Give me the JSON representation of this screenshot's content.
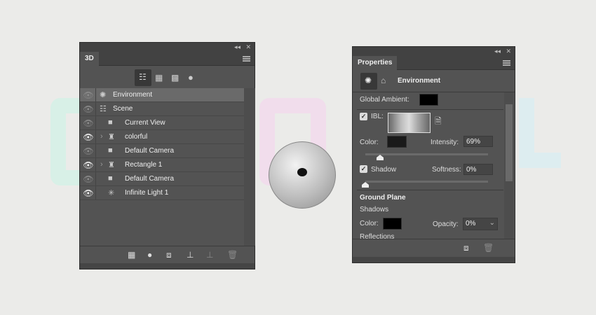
{
  "panel3d": {
    "tab": "3D",
    "filters": [
      "scene-filter",
      "mesh-filter",
      "material-filter",
      "light-filter"
    ],
    "layers": [
      {
        "label": "Environment",
        "visible": false,
        "icon": "environment-icon",
        "indent": 0,
        "selected": true
      },
      {
        "label": "Scene",
        "visible": false,
        "icon": "scene-icon",
        "indent": 0
      },
      {
        "label": "Current View",
        "visible": false,
        "icon": "camera-icon",
        "indent": 1
      },
      {
        "label": "colorful",
        "visible": true,
        "icon": "mesh-icon",
        "indent": 1,
        "expand": true
      },
      {
        "label": "Default Camera",
        "visible": false,
        "icon": "camera-icon",
        "indent": 1
      },
      {
        "label": "Rectangle 1",
        "visible": true,
        "icon": "mesh-icon",
        "indent": 1,
        "expand": true
      },
      {
        "label": "Default Camera",
        "visible": false,
        "icon": "camera-icon",
        "indent": 1
      },
      {
        "label": "Infinite Light 1",
        "visible": true,
        "icon": "light-icon",
        "indent": 1
      }
    ]
  },
  "properties": {
    "tab": "Properties",
    "section": "Environment",
    "global_ambient_label": "Global Ambient:",
    "ibl_label": "IBL:",
    "ibl_checked": true,
    "color_label": "Color:",
    "intensity_label": "Intensity:",
    "intensity": "69%",
    "intensity_slider": 0.12,
    "shadow_label": "Shadow",
    "shadow_checked": true,
    "softness_label": "Softness:",
    "softness": "0%",
    "softness_slider": 0,
    "ground_plane": "Ground Plane",
    "shadows": "Shadows",
    "gp_color_label": "Color:",
    "opacity_label": "Opacity:",
    "opacity": "0%",
    "reflections": "Reflections"
  }
}
